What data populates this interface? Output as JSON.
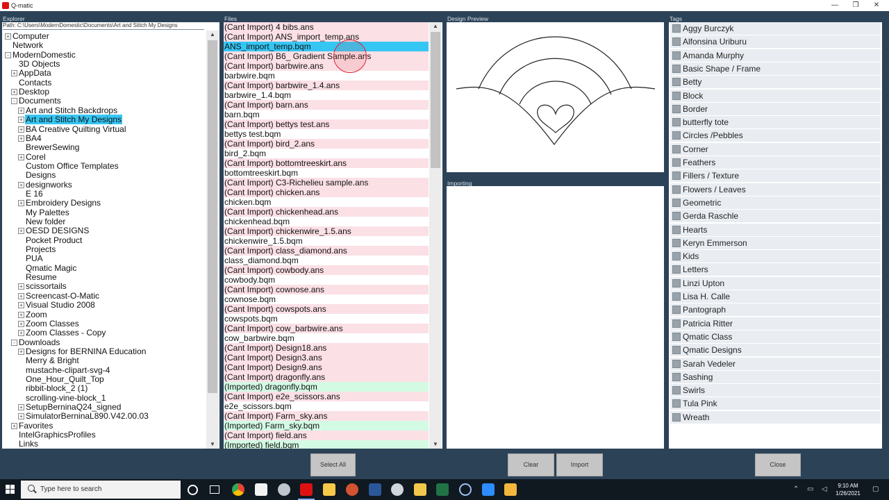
{
  "window": {
    "title": "Q-matic",
    "minimize": "—",
    "restore": "❐",
    "close": "✕"
  },
  "explorer": {
    "label": "Explorer",
    "path": "Path: C:\\Users\\ModernDomestic\\Documents\\Art and Stitch My Designs",
    "items": [
      {
        "label": "Computer",
        "expander": "+",
        "level": 0
      },
      {
        "label": "Network",
        "expander": "",
        "level": 0
      },
      {
        "label": "ModernDomestic",
        "expander": "-",
        "level": 0
      },
      {
        "label": "3D Objects",
        "expander": "",
        "level": 1
      },
      {
        "label": "AppData",
        "expander": "+",
        "level": 1
      },
      {
        "label": "Contacts",
        "expander": "",
        "level": 1
      },
      {
        "label": "Desktop",
        "expander": "+",
        "level": 1
      },
      {
        "label": "Documents",
        "expander": "-",
        "level": 1
      },
      {
        "label": "Art and Stitch Backdrops",
        "expander": "+",
        "level": 2
      },
      {
        "label": "Art and Stitch My Designs",
        "expander": "+",
        "level": 2,
        "selected": true
      },
      {
        "label": "BA Creative Quilting Virtual",
        "expander": "+",
        "level": 2
      },
      {
        "label": "BA4",
        "expander": "+",
        "level": 2
      },
      {
        "label": "BrewerSewing",
        "expander": "",
        "level": 2
      },
      {
        "label": "Corel",
        "expander": "+",
        "level": 2
      },
      {
        "label": "Custom Office Templates",
        "expander": "",
        "level": 2
      },
      {
        "label": "Designs",
        "expander": "",
        "level": 2
      },
      {
        "label": "designworks",
        "expander": "+",
        "level": 2
      },
      {
        "label": "E 16",
        "expander": "",
        "level": 2
      },
      {
        "label": "Embroidery Designs",
        "expander": "+",
        "level": 2
      },
      {
        "label": "My Palettes",
        "expander": "",
        "level": 2
      },
      {
        "label": "New folder",
        "expander": "",
        "level": 2
      },
      {
        "label": "OESD DESIGNS",
        "expander": "+",
        "level": 2
      },
      {
        "label": "Pocket Product",
        "expander": "",
        "level": 2
      },
      {
        "label": "Projects",
        "expander": "",
        "level": 2
      },
      {
        "label": "PUA",
        "expander": "",
        "level": 2
      },
      {
        "label": "Qmatic Magic",
        "expander": "",
        "level": 2
      },
      {
        "label": "Resume",
        "expander": "",
        "level": 2
      },
      {
        "label": "scissortails",
        "expander": "+",
        "level": 2
      },
      {
        "label": "Screencast-O-Matic",
        "expander": "+",
        "level": 2
      },
      {
        "label": "Visual Studio 2008",
        "expander": "+",
        "level": 2
      },
      {
        "label": "Zoom",
        "expander": "+",
        "level": 2
      },
      {
        "label": "Zoom Classes",
        "expander": "+",
        "level": 2
      },
      {
        "label": "Zoom Classes - Copy",
        "expander": "+",
        "level": 2
      },
      {
        "label": "Downloads",
        "expander": "-",
        "level": 1
      },
      {
        "label": "Designs for BERNINA Education",
        "expander": "+",
        "level": 2
      },
      {
        "label": "Merry & Bright",
        "expander": "",
        "level": 2
      },
      {
        "label": "mustache-clipart-svg-4",
        "expander": "",
        "level": 2
      },
      {
        "label": "One_Hour_Quilt_Top",
        "expander": "",
        "level": 2
      },
      {
        "label": "ribbit-block_2 (1)",
        "expander": "",
        "level": 2
      },
      {
        "label": "scrolling-vine-block_1",
        "expander": "",
        "level": 2
      },
      {
        "label": "SetupBerninaQ24_signed",
        "expander": "+",
        "level": 2
      },
      {
        "label": "SimulatorBerninaL890.V42.00.03",
        "expander": "+",
        "level": 2
      },
      {
        "label": "Favorites",
        "expander": "+",
        "level": 1
      },
      {
        "label": "IntelGraphicsProfiles",
        "expander": "",
        "level": 1
      },
      {
        "label": "Links",
        "expander": "",
        "level": 1
      }
    ]
  },
  "files": {
    "label": "Files",
    "rows": [
      {
        "name": "(Cant Import) 4 bibs.ans",
        "status": "cant"
      },
      {
        "name": "(Cant Import) ANS_import_temp.ans",
        "status": "cant"
      },
      {
        "name": "ANS_import_temp.bqm",
        "status": "selected"
      },
      {
        "name": "(Cant Import) B6_ Gradient Sample.ans",
        "status": "cant"
      },
      {
        "name": "(Cant Import) barbwire.ans",
        "status": "cant"
      },
      {
        "name": "barbwire.bqm",
        "status": "plain"
      },
      {
        "name": "(Cant Import) barbwire_1.4.ans",
        "status": "cant"
      },
      {
        "name": "barbwire_1.4.bqm",
        "status": "plain"
      },
      {
        "name": "(Cant Import) barn.ans",
        "status": "cant"
      },
      {
        "name": "barn.bqm",
        "status": "plain"
      },
      {
        "name": "(Cant Import) bettys test.ans",
        "status": "cant"
      },
      {
        "name": "bettys test.bqm",
        "status": "plain"
      },
      {
        "name": "(Cant Import) bird_2.ans",
        "status": "cant"
      },
      {
        "name": "bird_2.bqm",
        "status": "plain"
      },
      {
        "name": "(Cant Import) bottomtreeskirt.ans",
        "status": "cant"
      },
      {
        "name": "bottomtreeskirt.bqm",
        "status": "plain"
      },
      {
        "name": "(Cant Import) C3-Richelieu sample.ans",
        "status": "cant"
      },
      {
        "name": "(Cant Import) chicken.ans",
        "status": "cant"
      },
      {
        "name": "chicken.bqm",
        "status": "plain"
      },
      {
        "name": "(Cant Import) chickenhead.ans",
        "status": "cant"
      },
      {
        "name": "chickenhead.bqm",
        "status": "plain"
      },
      {
        "name": "(Cant Import) chickenwire_1.5.ans",
        "status": "cant"
      },
      {
        "name": "chickenwire_1.5.bqm",
        "status": "plain"
      },
      {
        "name": "(Cant Import) class_diamond.ans",
        "status": "cant"
      },
      {
        "name": "class_diamond.bqm",
        "status": "plain"
      },
      {
        "name": "(Cant Import) cowbody.ans",
        "status": "cant"
      },
      {
        "name": "cowbody.bqm",
        "status": "plain"
      },
      {
        "name": "(Cant Import) cownose.ans",
        "status": "cant"
      },
      {
        "name": "cownose.bqm",
        "status": "plain"
      },
      {
        "name": "(Cant Import) cowspots.ans",
        "status": "cant"
      },
      {
        "name": "cowspots.bqm",
        "status": "plain"
      },
      {
        "name": "(Cant Import) cow_barbwire.ans",
        "status": "cant"
      },
      {
        "name": "cow_barbwire.bqm",
        "status": "plain"
      },
      {
        "name": "(Cant Import) Design18.ans",
        "status": "cant"
      },
      {
        "name": "(Cant Import) Design3.ans",
        "status": "cant"
      },
      {
        "name": "(Cant Import) Design9.ans",
        "status": "cant"
      },
      {
        "name": "(Cant Import) dragonfly.ans",
        "status": "cant"
      },
      {
        "name": "(Imported) dragonfly.bqm",
        "status": "imported"
      },
      {
        "name": "(Cant Import) e2e_scissors.ans",
        "status": "cant"
      },
      {
        "name": "e2e_scissors.bqm",
        "status": "plain"
      },
      {
        "name": "(Cant Import) Farm_sky.ans",
        "status": "cant"
      },
      {
        "name": "(Imported) Farm_sky.bqm",
        "status": "imported"
      },
      {
        "name": "(Cant Import) field.ans",
        "status": "cant"
      },
      {
        "name": "(Imported) field.bqm",
        "status": "imported"
      }
    ]
  },
  "preview": {
    "label": "Design Preview"
  },
  "importing": {
    "label": "Importing"
  },
  "tags": {
    "label": "Tags",
    "items": [
      "Aggy Burczyk",
      "Alfonsina Uriburu",
      "Amanda Murphy",
      "Basic Shape / Frame",
      "Betty",
      "Block",
      "Border",
      "butterfly tote",
      "Circles /Pebbles",
      "Corner",
      "Feathers",
      "Fillers / Texture",
      "Flowers / Leaves",
      "Geometric",
      "Gerda Raschle",
      "Hearts",
      "Keryn Emmerson",
      "Kids",
      "Letters",
      "Linzi Upton",
      "Lisa H. Calle",
      "Pantograph",
      "Patricia Ritter",
      "Qmatic Class",
      "Qmatic Designs",
      "Sarah Vedeler",
      "Sashing",
      "Swirls",
      "Tula Pink",
      "Wreath"
    ]
  },
  "buttons": {
    "select_all": "Select All",
    "clear": "Clear",
    "import": "Import",
    "close": "Close"
  },
  "taskbar": {
    "search_placeholder": "Type here to search",
    "time": "9:10 AM",
    "date": "1/26/2021",
    "icons": [
      "cortana-icon",
      "task-view-icon",
      "chrome-icon",
      "store-icon",
      "settings-icon",
      "qmatic-icon",
      "file-explorer-icon",
      "powerpoint-icon",
      "word-icon",
      "app-icon",
      "sticky-icon",
      "excel-icon",
      "media-icon",
      "zoom-icon",
      "notes-icon"
    ]
  },
  "colors": {
    "workspace": "#2c4257",
    "selection": "#36c6f4",
    "cant_import_row": "#fbe0e6",
    "imported_row": "#d3fbe4"
  }
}
